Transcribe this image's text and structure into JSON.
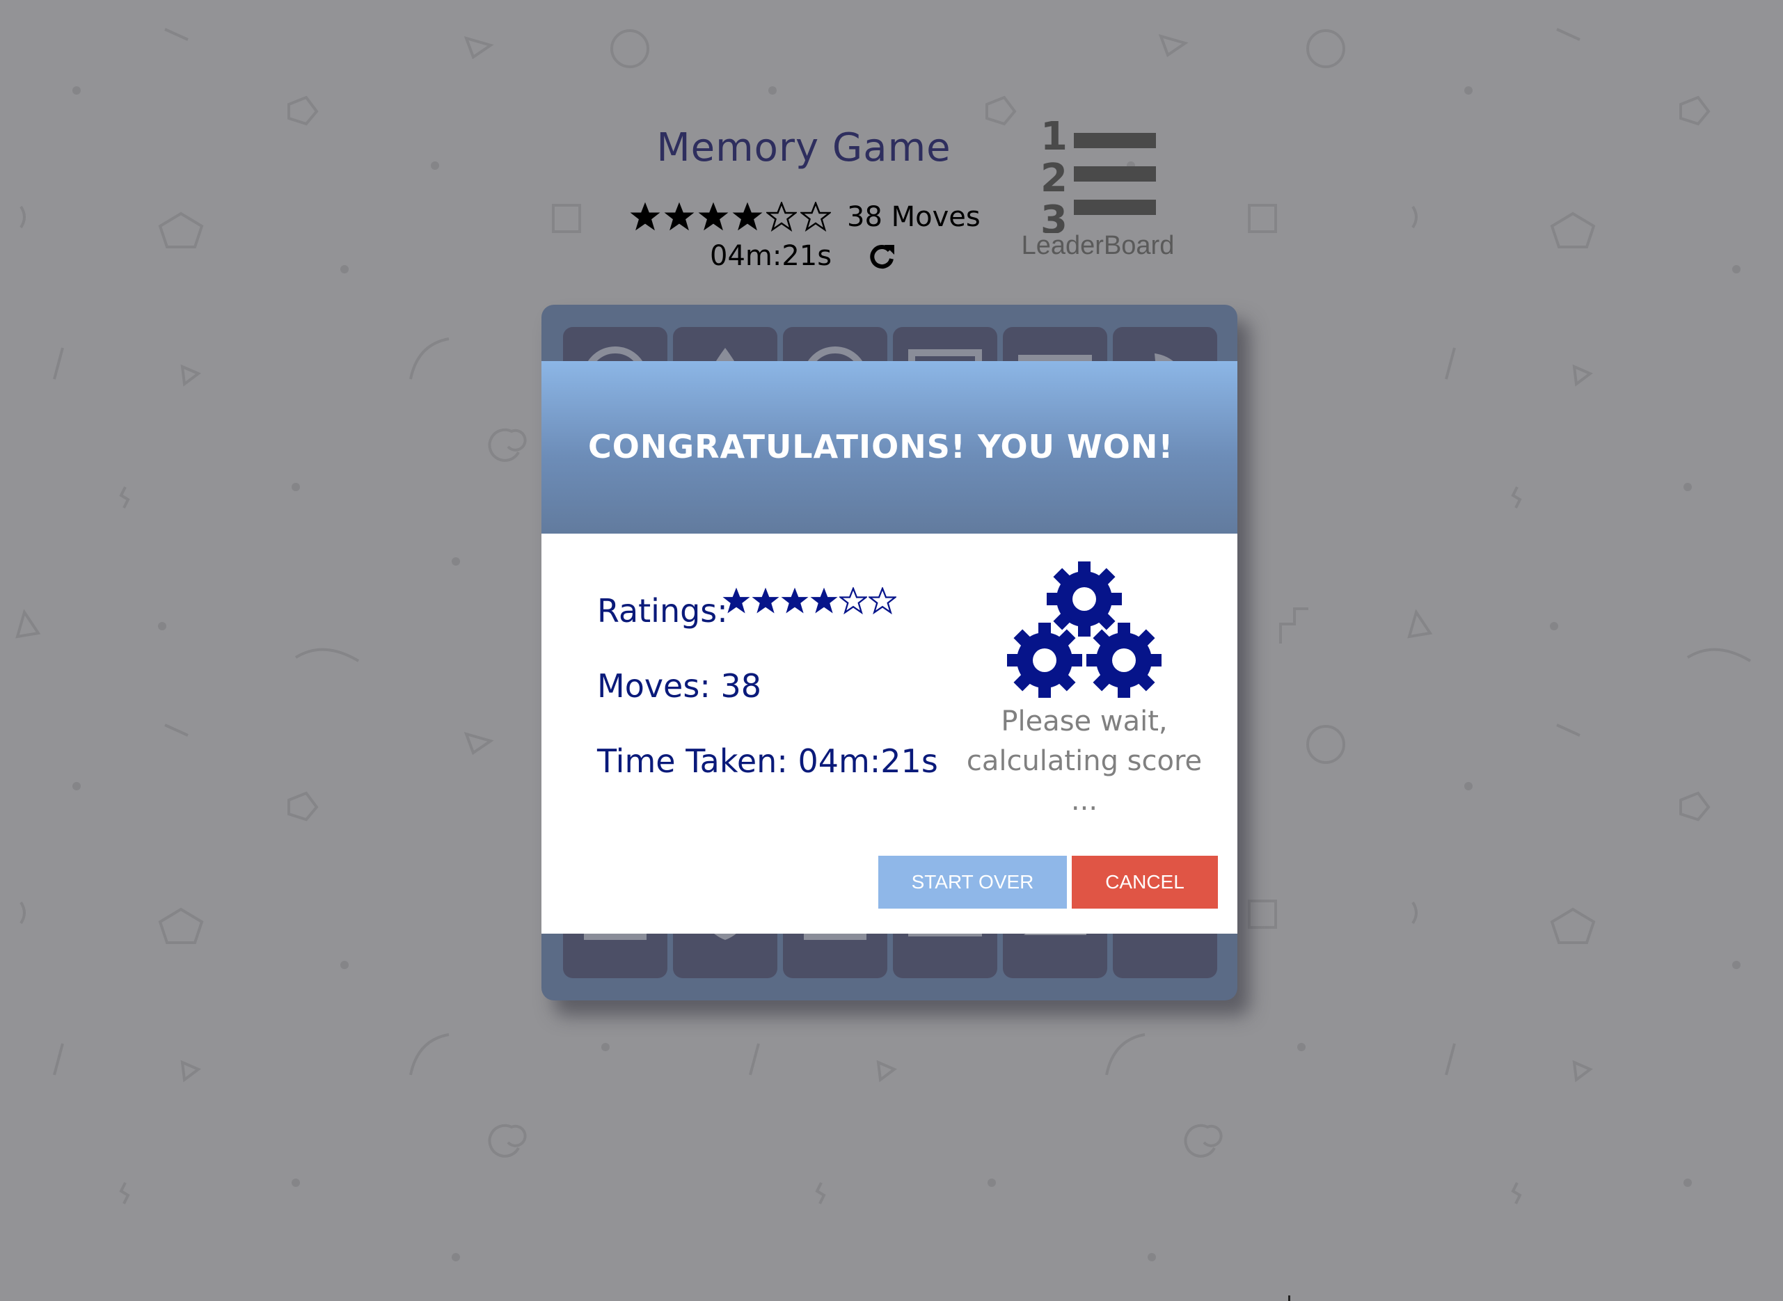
{
  "header": {
    "title": "Memory Game",
    "star_rating": 4,
    "star_total": 6,
    "moves_label": "38 Moves",
    "timer": "04m:21s",
    "leaderboard_label": "LeaderBoard"
  },
  "modal": {
    "title": "CONGRATULATIONS! YOU WON!",
    "ratings_label": "Ratings:",
    "rating_filled": 4,
    "rating_total": 6,
    "moves_label": "Moves: 38",
    "time_label": "Time Taken: 04m:21s",
    "wait_line1": "Please wait,",
    "wait_line2": "calculating score",
    "wait_line3": "...",
    "start_over_label": "START OVER",
    "cancel_label": "CANCEL"
  },
  "colors": {
    "background": "#939396",
    "title": "#2e2e5e",
    "board": "#5b6b86",
    "card": "#4c4f66",
    "modal_text": "#0a1a7a",
    "start_over": "#8fb7e8",
    "cancel": "#e05545"
  },
  "icons": {
    "rating_star": "star-icon",
    "restart": "restart-icon",
    "leaderboard": "leaderboard-icon",
    "loading": "gears-icon"
  }
}
